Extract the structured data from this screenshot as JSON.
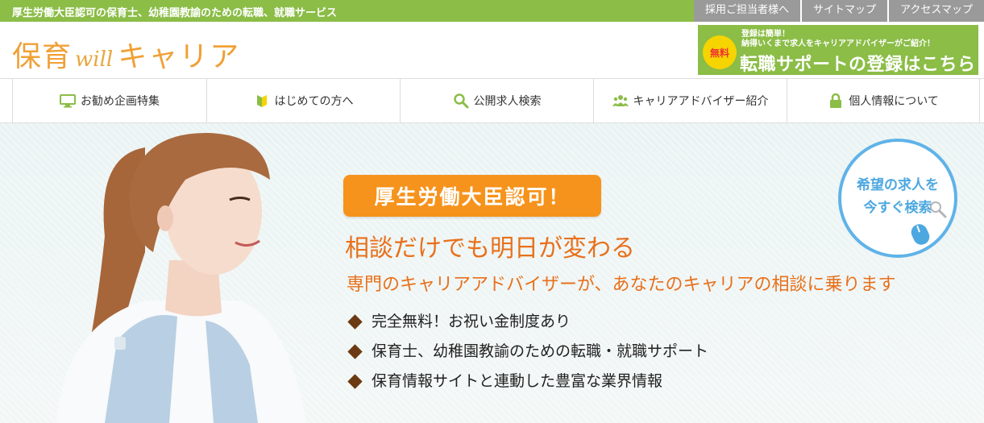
{
  "topbar": {
    "tagline": "厚生労働大臣認可の保育士、幼稚園教諭のための転職、就職サービス",
    "links": [
      "採用ご担当者様へ",
      "サイトマップ",
      "アクセスマップ"
    ]
  },
  "header": {
    "logo": {
      "part1": "保育",
      "part2": "will",
      "part3": "キャリア"
    },
    "register": {
      "badge": "無料",
      "small_line1": "登録は簡単！",
      "small_line2": "納得いくまで求人をキャリアアドバイザーがご紹介！",
      "big": "転職サポートの登録はこちら"
    }
  },
  "nav": {
    "items": [
      {
        "label": "お勧め企画特集",
        "icon": "monitor-icon"
      },
      {
        "label": "はじめての方へ",
        "icon": "leaf-icon"
      },
      {
        "label": "公開求人検索",
        "icon": "search-icon"
      },
      {
        "label": "キャリアアドバイザー紹介",
        "icon": "people-icon"
      },
      {
        "label": "個人情報について",
        "icon": "lock-icon"
      }
    ]
  },
  "hero": {
    "badge": "厚生労働大臣認可！",
    "headline": "相談だけでも明日が変わる",
    "subline": "専門のキャリアアドバイザーが、あなたのキャリアの相談に乗ります",
    "bullets": [
      "完全無料！お祝い金制度あり",
      "保育士、幼稚園教諭のための転職・就職サポート",
      "保育情報サイトと連動した豊富な業界情報"
    ],
    "search_cta": {
      "line1": "希望の求人を",
      "line2": "今すぐ検索"
    }
  },
  "colors": {
    "green": "#8bbd47",
    "orange": "#f6931c",
    "text_orange": "#e8701b",
    "blue": "#5fb3e8",
    "gray_link": "#9a9a9a"
  }
}
